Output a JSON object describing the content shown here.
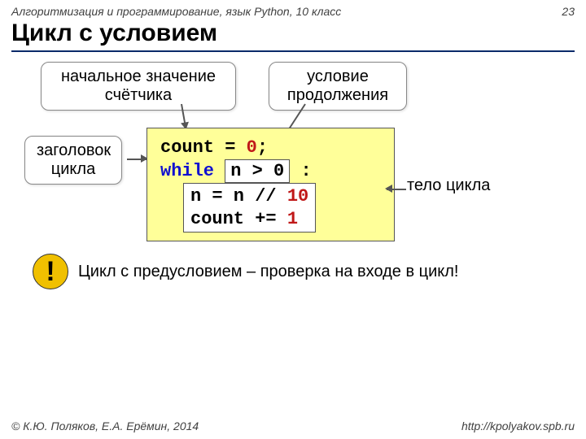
{
  "header": {
    "course": "Алгоритмизация и программирование, язык Python, 10 класс",
    "page": "23"
  },
  "title": "Цикл с условием",
  "bubbles": {
    "init": "начальное значение\nсчётчика",
    "cond": "условие\nпродолжения",
    "head": "заголовок\nцикла",
    "body_label": "тело цикла"
  },
  "code": {
    "l1a": "count",
    "l1b": " = ",
    "l1c": "0",
    "l1d": ";",
    "kw_while": "while",
    "cond_expr": "n > 0",
    "colon": ":",
    "body1a": "n = n // ",
    "body1b": "10",
    "body2a": "count += ",
    "body2b": "1"
  },
  "note": {
    "bang": "!",
    "text": "Цикл с предусловием – проверка на входе в цикл!"
  },
  "footer": {
    "left": "© К.Ю. Поляков, Е.А. Ерёмин, 2014",
    "right": "http://kpolyakov.spb.ru"
  }
}
